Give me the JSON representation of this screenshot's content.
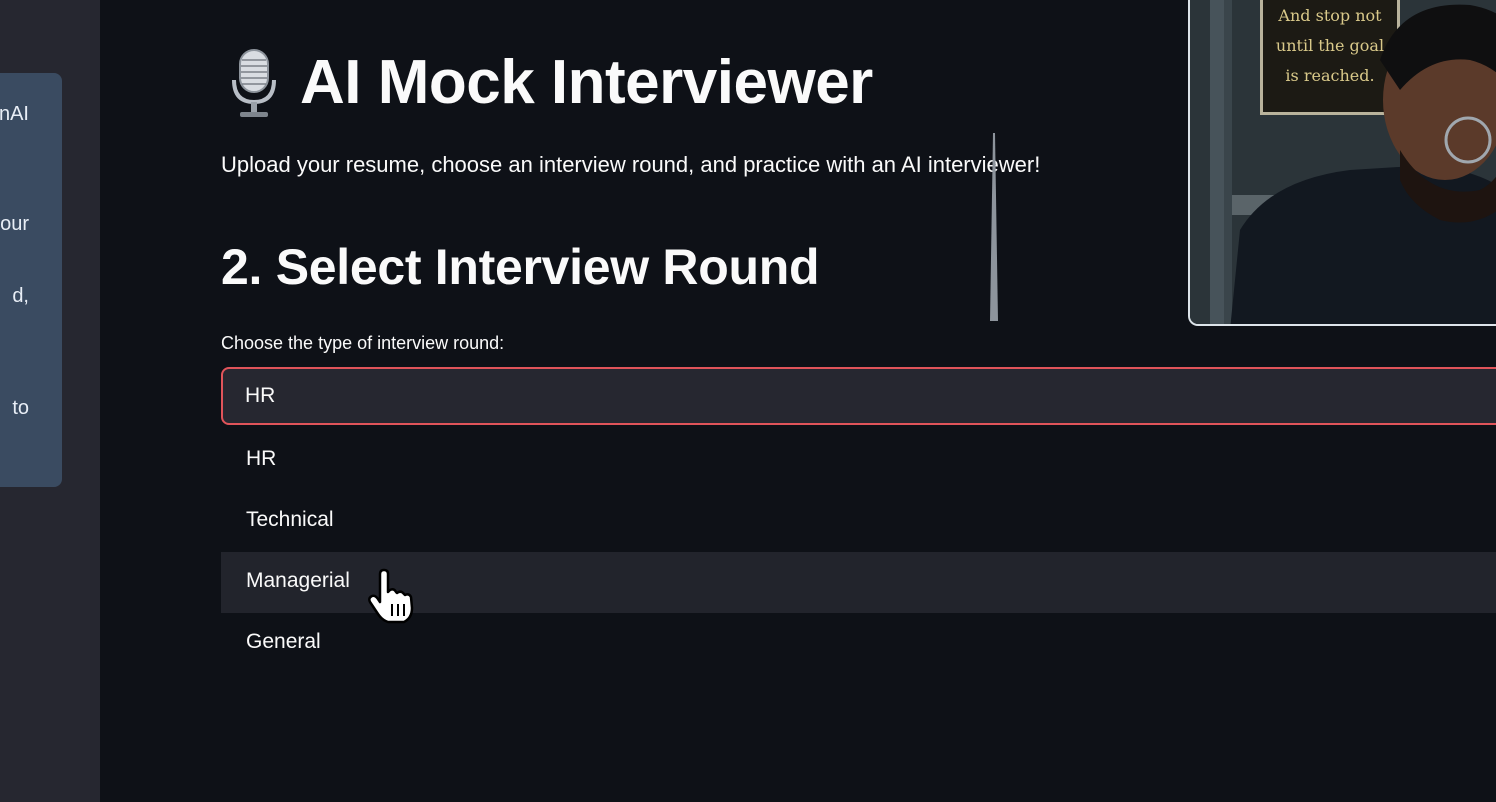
{
  "sidebar": {
    "fragments": [
      "nAI",
      "our",
      "d,",
      "to"
    ]
  },
  "header": {
    "title": "AI Mock Interviewer",
    "icon": "microphone-icon"
  },
  "subtitle": "Upload your resume, choose an interview round, and practice with an AI interviewer!",
  "section": {
    "heading": "2. Select Interview Round",
    "label": "Choose the type of interview round:",
    "selected": "HR",
    "options": [
      "HR",
      "Technical",
      "Managerial",
      "General"
    ],
    "hovered": "Managerial"
  },
  "webcam": {
    "poster_lines": [
      "And stop not",
      "until the goal",
      "is reached."
    ]
  },
  "colors": {
    "background": "#0e1117",
    "sidebar": "#262730",
    "select_border": "#e0545a",
    "hover": "#22242c"
  }
}
